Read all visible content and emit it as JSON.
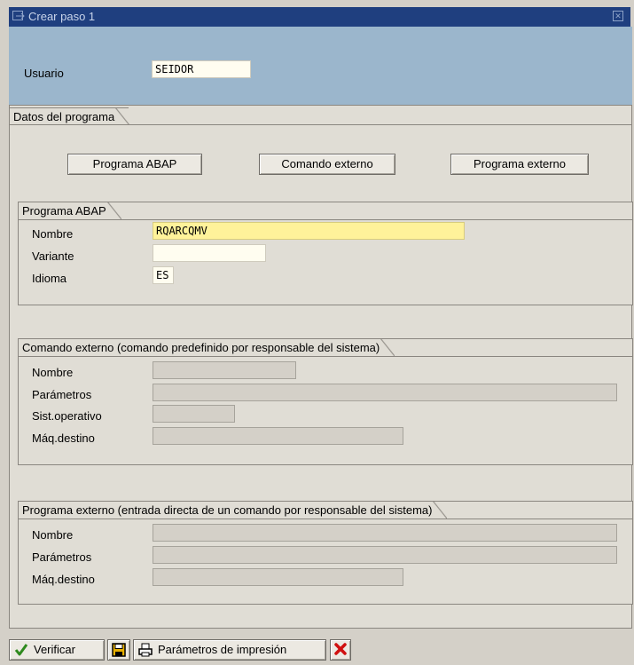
{
  "window": {
    "title": "Crear paso 1"
  },
  "user": {
    "label": "Usuario",
    "value": "SEIDOR"
  },
  "program_data": {
    "title": "Datos del programa",
    "buttons": {
      "abap": "Programa ABAP",
      "external_command": "Comando externo",
      "external_program": "Programa externo"
    }
  },
  "abap_program": {
    "title": "Programa ABAP",
    "name_label": "Nombre",
    "name_value": "RQARCQMV",
    "variant_label": "Variante",
    "variant_value": "",
    "language_label": "Idioma",
    "language_value": "ES"
  },
  "external_command": {
    "title": "Comando externo (comando predefinido por responsable del sistema)",
    "name_label": "Nombre",
    "params_label": "Parámetros",
    "os_label": "Sist.operativo",
    "target_label": "Máq.destino"
  },
  "external_program": {
    "title": "Programa externo (entrada directa de un comando por responsable del sistema)",
    "name_label": "Nombre",
    "params_label": "Parámetros",
    "target_label": "Máq.destino"
  },
  "toolbar": {
    "verify_label": "Verificar",
    "print_params_label": "Parámetros de impresión"
  },
  "colors": {
    "titlebar": "#1f3f7f",
    "user_band": "#9bb6cc",
    "panel": "#e0ddd5",
    "required_field": "#fff29a"
  },
  "icons": {
    "title": "window-icon",
    "verify": "checkmark-icon",
    "save": "save-icon",
    "print_params": "printer-icon",
    "cancel": "cancel-icon",
    "close": "close-icon"
  }
}
